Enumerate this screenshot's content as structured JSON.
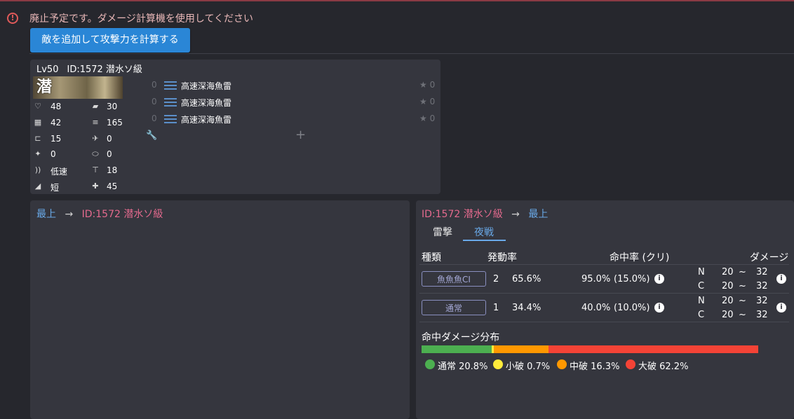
{
  "warning": {
    "text": "廃止予定です。ダメージ計算機を使用してください",
    "icon": "alert-circle-icon"
  },
  "actions": {
    "add_enemy_label": "敵を追加して攻撃力を計算する"
  },
  "ship": {
    "level": "Lv50",
    "name": "ID:1572 潜水ソ級",
    "banner_char": "潜",
    "stats": [
      {
        "icon": "heart-icon",
        "glyph": "♡",
        "value": "48"
      },
      {
        "icon": "armor-icon",
        "glyph": "▰",
        "value": "30"
      },
      {
        "icon": "evasion-icon",
        "glyph": "▦",
        "value": "42"
      },
      {
        "icon": "ammo-icon",
        "glyph": "≡",
        "value": "165"
      },
      {
        "icon": "torpedo-icon",
        "glyph": "⊏",
        "value": "15"
      },
      {
        "icon": "aa-icon",
        "glyph": "✈",
        "value": "0"
      },
      {
        "icon": "asw-icon",
        "glyph": "✦",
        "value": "0"
      },
      {
        "icon": "los-icon",
        "glyph": "⬭",
        "value": "0"
      },
      {
        "icon": "speed-icon",
        "glyph": "))",
        "value": "低速"
      },
      {
        "icon": "luck-icon",
        "glyph": "⊤",
        "value": "18"
      },
      {
        "icon": "range-icon",
        "glyph": "◢",
        "value": "短"
      },
      {
        "icon": "lifebuoy-icon",
        "glyph": "✚",
        "value": "45"
      }
    ],
    "equipment": [
      {
        "count": "0",
        "name": "高速深海魚雷",
        "star": "★ 0"
      },
      {
        "count": "0",
        "name": "高速深海魚雷",
        "star": "★ 0"
      },
      {
        "count": "0",
        "name": "高速深海魚雷",
        "star": "★ 0"
      }
    ],
    "add_slot": "+"
  },
  "left_panel": {
    "from": "最上",
    "arrow": "→",
    "to": "ID:1572 潜水ソ級"
  },
  "right_panel": {
    "from": "ID:1572 潜水ソ級",
    "arrow": "→",
    "to": "最上",
    "tabs": [
      "雷撃",
      "夜戦"
    ],
    "headers": {
      "type": "種類",
      "rate": "発動率",
      "hit": "命中率 (クリ)",
      "damage": "ダメージ"
    },
    "rows": [
      {
        "type": "魚魚魚CI",
        "mult": "2",
        "rate": "65.6%",
        "hit": "95.0%",
        "crit": "(15.0%)",
        "n_label": "N",
        "n_min": "20",
        "n_tilde": "~",
        "n_max": "32",
        "c_label": "C",
        "c_min": "20",
        "c_tilde": "~",
        "c_max": "32"
      },
      {
        "type": "通常",
        "mult": "1",
        "rate": "34.4%",
        "hit": "40.0%",
        "crit": "(10.0%)",
        "n_label": "N",
        "n_min": "20",
        "n_tilde": "~",
        "n_max": "32",
        "c_label": "C",
        "c_min": "20",
        "c_tilde": "~",
        "c_max": "32"
      }
    ],
    "distribution": {
      "title": "命中ダメージ分布",
      "segments": [
        {
          "label": "通常 20.8%",
          "fraction": 0.208,
          "color": "#4caf50"
        },
        {
          "label": "小破 0.7%",
          "fraction": 0.007,
          "color": "#ffeb3b"
        },
        {
          "label": "中破 16.3%",
          "fraction": 0.163,
          "color": "#ff9800"
        },
        {
          "label": "大破 62.2%",
          "fraction": 0.622,
          "color": "#f44336"
        }
      ]
    }
  }
}
